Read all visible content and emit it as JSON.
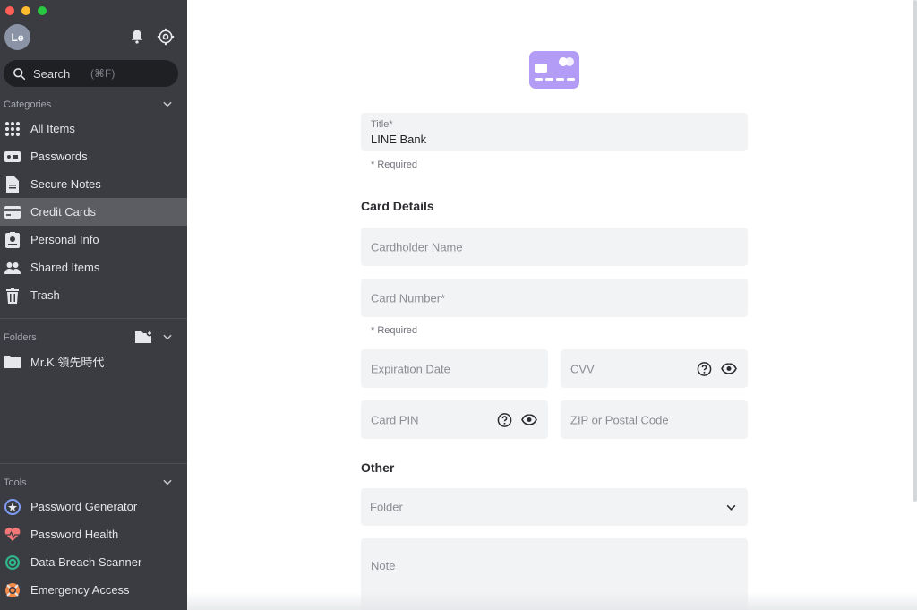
{
  "user": {
    "avatar_initials": "Le"
  },
  "search": {
    "placeholder": "Search",
    "shortcut": "(⌘F)"
  },
  "categories": {
    "header": "Categories",
    "items": [
      {
        "label": "All Items",
        "icon": "grid-icon"
      },
      {
        "label": "Passwords",
        "icon": "password-icon"
      },
      {
        "label": "Secure Notes",
        "icon": "note-icon"
      },
      {
        "label": "Credit Cards",
        "icon": "credit-card-icon",
        "active": true
      },
      {
        "label": "Personal Info",
        "icon": "id-card-icon"
      },
      {
        "label": "Shared Items",
        "icon": "users-icon"
      },
      {
        "label": "Trash",
        "icon": "trash-icon"
      }
    ]
  },
  "folders": {
    "header": "Folders",
    "items": [
      {
        "label": "Mr.K 領先時代",
        "icon": "folder-icon"
      }
    ]
  },
  "tools": {
    "header": "Tools",
    "items": [
      {
        "label": "Password Generator",
        "icon": "generator-icon"
      },
      {
        "label": "Password Health",
        "icon": "heart-icon"
      },
      {
        "label": "Data Breach Scanner",
        "icon": "radar-icon"
      },
      {
        "label": "Emergency Access",
        "icon": "lifebuoy-icon"
      }
    ]
  },
  "form": {
    "title_label": "Title*",
    "title_value": "LINE Bank",
    "title_required": "* Required",
    "card_details_heading": "Card Details",
    "cardholder_placeholder": "Cardholder Name",
    "card_number_placeholder": "Card Number*",
    "card_number_required": "* Required",
    "expiration_placeholder": "Expiration Date",
    "cvv_placeholder": "CVV",
    "pin_placeholder": "Card PIN",
    "zip_placeholder": "ZIP or Postal Code",
    "other_heading": "Other",
    "folder_placeholder": "Folder",
    "note_placeholder": "Note"
  },
  "colors": {
    "sidebar_bg": "#3b3c41",
    "active_item_bg": "#5b5d63",
    "card_icon": "#b39cf6",
    "field_bg": "#f2f3f5"
  }
}
